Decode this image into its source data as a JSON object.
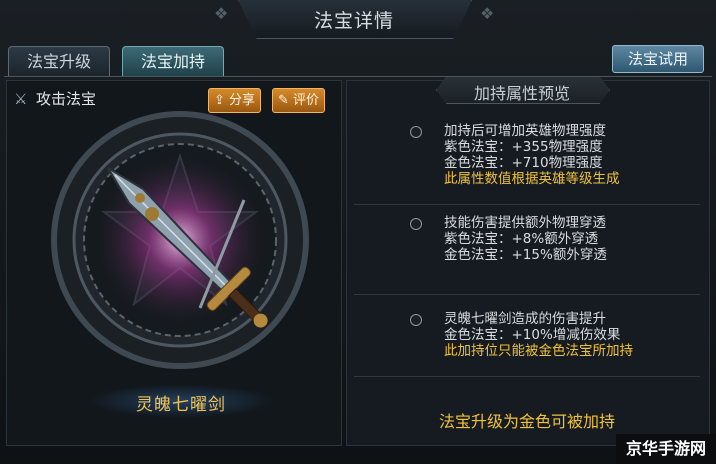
{
  "window": {
    "title": "法宝详情"
  },
  "tabs": [
    {
      "label": "法宝升级",
      "active": false
    },
    {
      "label": "法宝加持",
      "active": true
    }
  ],
  "try_button": "法宝试用",
  "treasure": {
    "type_icon": "crossed-swords-icon",
    "type_label": "攻击法宝",
    "share_label": "分享",
    "rate_label": "评价",
    "name": "灵魄七曜剑"
  },
  "preview": {
    "title": "加持属性预览",
    "blocks": [
      {
        "lines": [
          "加持后可增加英雄物理强度",
          "紫色法宝：+355物理强度",
          "金色法宝：+710物理强度"
        ],
        "note": "此属性数值根据英雄等级生成"
      },
      {
        "lines": [
          "技能伤害提供额外物理穿透",
          "紫色法宝：+8%额外穿透",
          "金色法宝：+15%额外穿透"
        ],
        "note": ""
      },
      {
        "lines": [
          "灵魄七曜剑造成的伤害提升",
          "金色法宝：+10%增减伤效果"
        ],
        "note": "此加持位只能被金色法宝所加持"
      }
    ],
    "bottom_note": "法宝升级为金色可被加持"
  },
  "watermark": "京华手游网",
  "colors": {
    "accent_gold": "#f0c23a",
    "button_orange": "#d58a2a",
    "tab_active": "#3c6a76"
  }
}
